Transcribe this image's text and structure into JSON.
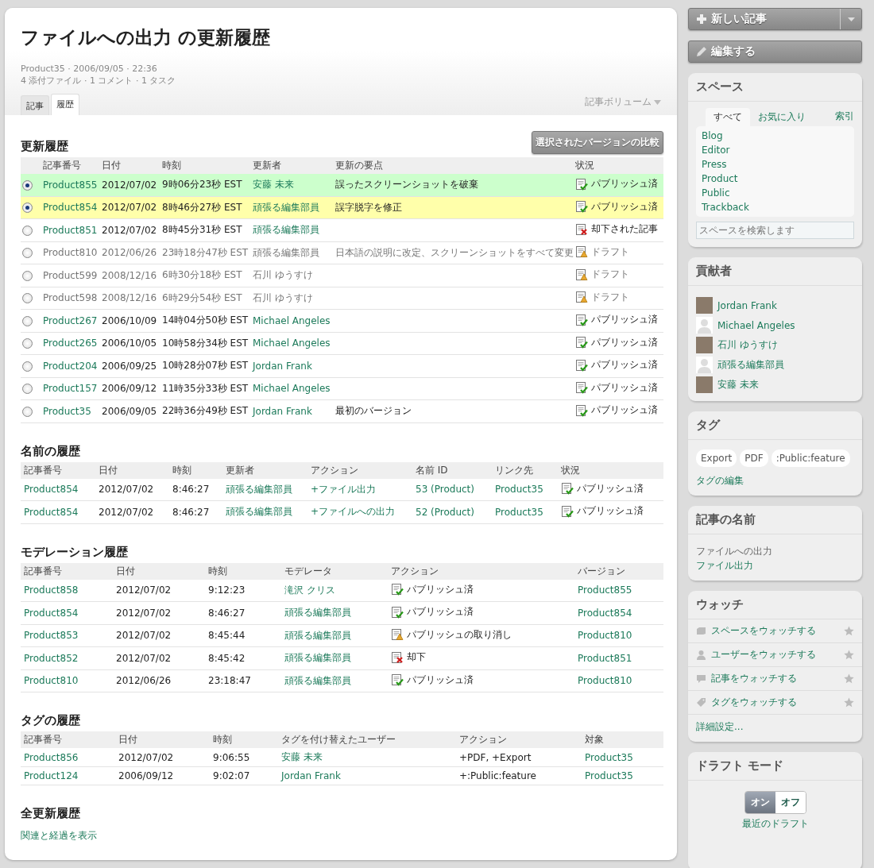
{
  "header": {
    "title": "ファイルへの出力 の更新履歴",
    "meta": [
      "Product35 · 2006/09/05 · 22:36",
      "4 添付ファイル · 1 コメント · 1 タスク"
    ],
    "tabs": [
      {
        "label": "記事",
        "selected": false
      },
      {
        "label": "履歴",
        "selected": true
      }
    ],
    "volume_menu": "記事ボリューム"
  },
  "revisions": {
    "title": "更新履歴",
    "compare_button": "選択されたバージョンの比較",
    "columns": [
      {
        "label": "記事番号",
        "kind": "link"
      },
      {
        "label": "日付",
        "kind": "text"
      },
      {
        "label": "時刻",
        "kind": "text"
      },
      {
        "label": "更新者",
        "kind": "link"
      },
      {
        "label": "更新の要点",
        "kind": "text"
      },
      {
        "label": "状況",
        "kind": "status"
      }
    ],
    "rows": [
      {
        "selected": true,
        "muted": false,
        "color": "#ccffcc",
        "cells": [
          "Product855",
          "2012/07/02",
          "9時06分23秒 EST",
          "安藤 未来",
          "誤ったスクリーンショットを破棄",
          {
            "kind": "published",
            "label": "パブリッシュ済"
          }
        ]
      },
      {
        "selected": true,
        "muted": false,
        "color": "#ffffaa",
        "cells": [
          "Product854",
          "2012/07/02",
          "8時46分27秒 EST",
          "頑張る編集部員",
          "誤字脱字を修正",
          {
            "kind": "published",
            "label": "パブリッシュ済"
          }
        ]
      },
      {
        "selected": false,
        "muted": false,
        "cells": [
          "Product851",
          "2012/07/02",
          "8時45分31秒 EST",
          "頑張る編集部員",
          "",
          {
            "kind": "rejected",
            "label": "却下された記事"
          }
        ]
      },
      {
        "selected": false,
        "muted": true,
        "cells": [
          "Product810",
          "2012/06/26",
          "23時18分47秒 EST",
          "頑張る編集部員",
          "日本語の説明に改定、スクリーンショットをすべて変更",
          {
            "kind": "draft",
            "label": "ドラフト"
          }
        ]
      },
      {
        "selected": false,
        "muted": true,
        "cells": [
          "Product599",
          "2008/12/16",
          "6時30分18秒 EST",
          "石川 ゆうすけ",
          "",
          {
            "kind": "draft",
            "label": "ドラフト"
          }
        ]
      },
      {
        "selected": false,
        "muted": true,
        "cells": [
          "Product598",
          "2008/12/16",
          "6時29分54秒 EST",
          "石川 ゆうすけ",
          "",
          {
            "kind": "draft",
            "label": "ドラフト"
          }
        ]
      },
      {
        "selected": false,
        "muted": false,
        "cells": [
          "Product267",
          "2006/10/09",
          "14時04分50秒 EST",
          "Michael Angeles",
          "",
          {
            "kind": "published",
            "label": "パブリッシュ済"
          }
        ]
      },
      {
        "selected": false,
        "muted": false,
        "cells": [
          "Product265",
          "2006/10/05",
          "10時58分34秒 EST",
          "Michael Angeles",
          "",
          {
            "kind": "published",
            "label": "パブリッシュ済"
          }
        ]
      },
      {
        "selected": false,
        "muted": false,
        "cells": [
          "Product204",
          "2006/09/25",
          "10時28分07秒 EST",
          "Jordan Frank",
          "",
          {
            "kind": "published",
            "label": "パブリッシュ済"
          }
        ]
      },
      {
        "selected": false,
        "muted": false,
        "cells": [
          "Product157",
          "2006/09/12",
          "11時35分33秒 EST",
          "Michael Angeles",
          "",
          {
            "kind": "published",
            "label": "パブリッシュ済"
          }
        ]
      },
      {
        "selected": false,
        "muted": false,
        "cells": [
          "Product35",
          "2006/09/05",
          "22時36分49秒 EST",
          "Jordan Frank",
          "最初のバージョン",
          {
            "kind": "published",
            "label": "パブリッシュ済"
          }
        ]
      }
    ]
  },
  "name_history": {
    "title": "名前の履歴",
    "columns": [
      {
        "label": "記事番号",
        "kind": "link"
      },
      {
        "label": "日付",
        "kind": "text"
      },
      {
        "label": "時刻",
        "kind": "text"
      },
      {
        "label": "更新者",
        "kind": "link"
      },
      {
        "label": "アクション",
        "kind": "link"
      },
      {
        "label": "名前 ID",
        "kind": "link"
      },
      {
        "label": "リンク先",
        "kind": "link"
      },
      {
        "label": "状況",
        "kind": "status"
      }
    ],
    "rows": [
      {
        "cells": [
          "Product854",
          "2012/07/02",
          "8:46:27",
          "頑張る編集部員",
          "+ファイル出力",
          "53 (Product)",
          "Product35",
          {
            "kind": "published",
            "label": "パブリッシュ済"
          }
        ]
      },
      {
        "cells": [
          "Product854",
          "2012/07/02",
          "8:46:27",
          "頑張る編集部員",
          "+ファイルへの出力",
          "52 (Product)",
          "Product35",
          {
            "kind": "published",
            "label": "パブリッシュ済"
          }
        ]
      }
    ]
  },
  "moderation_history": {
    "title": "モデレーション履歴",
    "columns": [
      {
        "label": "記事番号",
        "kind": "link"
      },
      {
        "label": "日付",
        "kind": "text"
      },
      {
        "label": "時刻",
        "kind": "text"
      },
      {
        "label": "モデレータ",
        "kind": "link"
      },
      {
        "label": "アクション",
        "kind": "status"
      },
      {
        "label": "バージョン",
        "kind": "link"
      }
    ],
    "rows": [
      {
        "cells": [
          "Product858",
          "2012/07/02",
          "9:12:23",
          "滝沢 クリス",
          {
            "kind": "published",
            "label": "パブリッシュ済"
          },
          "Product855"
        ]
      },
      {
        "cells": [
          "Product854",
          "2012/07/02",
          "8:46:27",
          "頑張る編集部員",
          {
            "kind": "published",
            "label": "パブリッシュ済"
          },
          "Product854"
        ]
      },
      {
        "cells": [
          "Product853",
          "2012/07/02",
          "8:45:44",
          "頑張る編集部員",
          {
            "kind": "draft",
            "label": "パブリッシュの取り消し"
          },
          "Product810"
        ]
      },
      {
        "cells": [
          "Product852",
          "2012/07/02",
          "8:45:42",
          "頑張る編集部員",
          {
            "kind": "rejected",
            "label": "却下"
          },
          "Product851"
        ]
      },
      {
        "cells": [
          "Product810",
          "2012/06/26",
          "23:18:47",
          "頑張る編集部員",
          {
            "kind": "published",
            "label": "パブリッシュ済"
          },
          "Product810"
        ]
      }
    ]
  },
  "tag_history": {
    "title": "タグの履歴",
    "columns": [
      {
        "label": "記事番号",
        "kind": "link"
      },
      {
        "label": "日付",
        "kind": "text"
      },
      {
        "label": "時刻",
        "kind": "text"
      },
      {
        "label": "タグを付け替えたユーザー",
        "kind": "link"
      },
      {
        "label": "アクション",
        "kind": "text"
      },
      {
        "label": "対象",
        "kind": "link"
      }
    ],
    "rows": [
      {
        "cells": [
          "Product856",
          "2012/07/02",
          "9:06:55",
          "安藤 未来",
          "+PDF, +Export",
          "Product35"
        ]
      },
      {
        "cells": [
          "Product124",
          "2006/09/12",
          "9:02:07",
          "Jordan Frank",
          "+:Public:feature",
          "Product35"
        ]
      }
    ]
  },
  "all_history": {
    "title": "全更新履歴",
    "link": "関連と経過を表示"
  },
  "sidebar": {
    "new_button": "新しい記事",
    "edit_button": "編集する",
    "spaces": {
      "title": "スペース",
      "tabs": [
        {
          "label": "すべて",
          "selected": true
        },
        {
          "label": "お気に入り",
          "selected": false
        }
      ],
      "index_link": "索引",
      "items": [
        "Blog",
        "Editor",
        "Press",
        "Product",
        "Public",
        "Trackback"
      ],
      "search": {
        "placeholder": "スペースを検索します"
      }
    },
    "contributors": {
      "title": "貢献者",
      "people": [
        {
          "name": "Jordan Frank",
          "kind": "photo"
        },
        {
          "name": "Michael Angeles",
          "kind": "default"
        },
        {
          "name": "石川 ゆうすけ",
          "kind": "photo"
        },
        {
          "name": "頑張る編集部員",
          "kind": "default"
        },
        {
          "name": "安藤 未来",
          "kind": "photo"
        }
      ]
    },
    "tags": {
      "title": "タグ",
      "items": [
        "Export",
        "PDF",
        ":Public:feature"
      ],
      "edit_link": "タグの編集"
    },
    "article_names": {
      "title": "記事の名前",
      "items": [
        {
          "label": "ファイルへの出力",
          "kind": "current"
        },
        {
          "label": "ファイル出力",
          "kind": "link"
        }
      ]
    },
    "watch": {
      "title": "ウォッチ",
      "items": [
        {
          "kind": "space",
          "label": "スペースをウォッチする"
        },
        {
          "kind": "user",
          "label": "ユーザーをウォッチする"
        },
        {
          "kind": "article",
          "label": "記事をウォッチする"
        },
        {
          "kind": "tag",
          "label": "タグをウォッチする"
        }
      ],
      "settings_link": "詳細設定..."
    },
    "draft_mode": {
      "title": "ドラフト モード",
      "options": [
        {
          "label": "オン",
          "selected": true
        },
        {
          "label": "オフ",
          "selected": false
        }
      ],
      "link": "最近のドラフト"
    }
  }
}
